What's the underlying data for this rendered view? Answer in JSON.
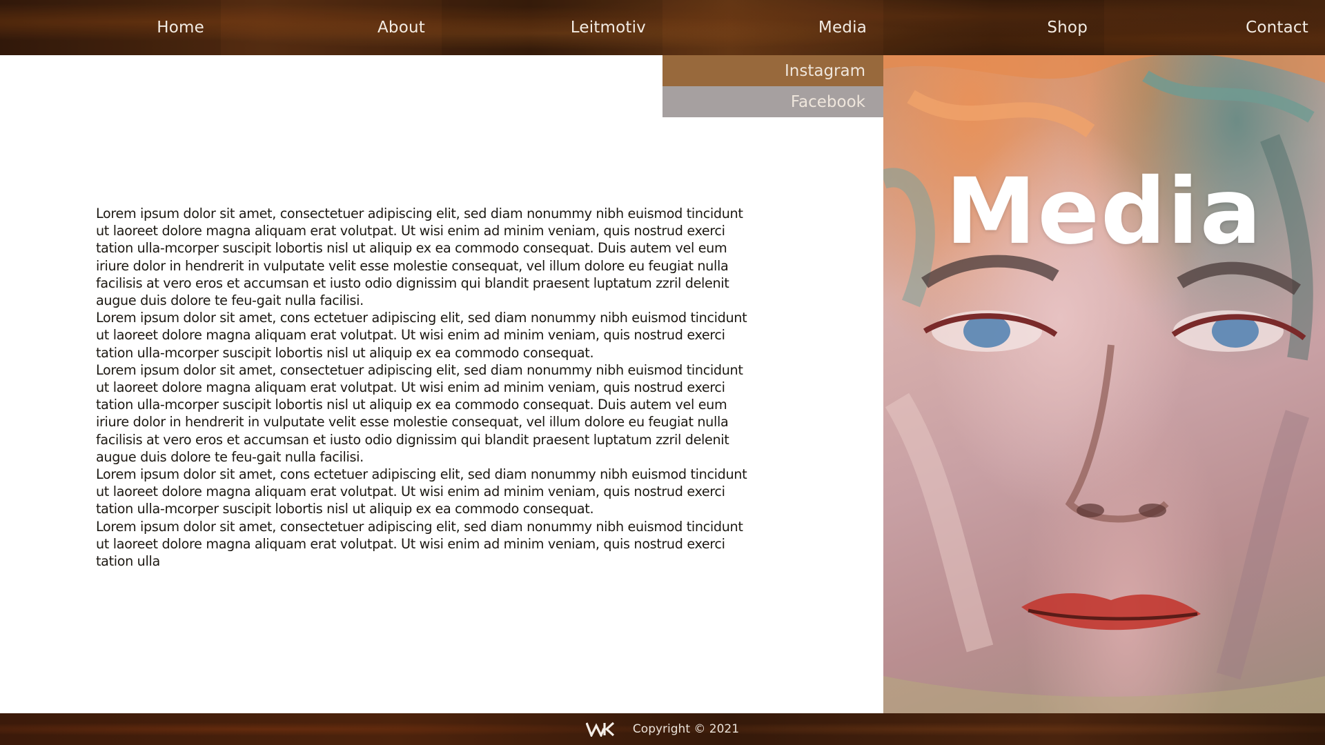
{
  "nav": {
    "items": [
      {
        "label": "Home"
      },
      {
        "label": "About"
      },
      {
        "label": "Leitmotiv"
      },
      {
        "label": "Media"
      },
      {
        "label": "Shop"
      },
      {
        "label": "Contact"
      }
    ],
    "dropdown": [
      {
        "label": "Instagram"
      },
      {
        "label": "Facebook"
      }
    ]
  },
  "hero": {
    "title": "Media"
  },
  "content": {
    "paragraphs": [
      "Lorem ipsum dolor sit amet, consectetuer adipiscing elit, sed diam nonummy nibh euismod tincidunt ut laoreet dolore magna aliquam erat volutpat. Ut wisi enim ad minim veniam, quis nostrud exerci tation ulla-mcorper suscipit lobortis nisl ut aliquip ex ea commodo consequat. Duis autem vel eum iriure dolor in hendrerit in vulputate velit esse molestie consequat, vel illum dolore eu feugiat nulla facilisis at vero eros et accumsan et iusto odio dignissim qui blandit praesent luptatum zzril delenit augue duis dolore te feu-gait nulla facilisi.",
      "Lorem ipsum dolor sit amet, cons ectetuer adipiscing elit, sed diam nonummy nibh euismod tincidunt ut laoreet dolore magna aliquam erat volutpat. Ut wisi enim ad minim veniam, quis nostrud exerci tation ulla-mcorper suscipit lobortis nisl ut aliquip ex ea commodo consequat.",
      "Lorem ipsum dolor sit amet, consectetuer adipiscing elit, sed diam nonummy nibh euismod tincidunt ut laoreet dolore magna aliquam erat volutpat. Ut wisi enim ad minim veniam, quis nostrud exerci tation ulla-mcorper suscipit lobortis nisl ut aliquip ex ea commodo consequat. Duis autem vel eum iriure dolor in hendrerit in vulputate velit esse molestie consequat, vel illum dolore eu feugiat nulla facilisis at vero eros et accumsan et iusto odio dignissim qui blandit praesent luptatum zzril delenit augue duis dolore te feu-gait nulla facilisi.",
      "Lorem ipsum dolor sit amet, cons ectetuer adipiscing elit, sed diam nonummy nibh euismod tincidunt ut laoreet dolore magna aliquam erat volutpat. Ut wisi enim ad minim veniam, quis nostrud exerci tation ulla-mcorper suscipit lobortis nisl ut aliquip ex ea commodo consequat.",
      "Lorem ipsum dolor sit amet, consectetuer adipiscing elit, sed diam nonummy nibh euismod tincidunt ut laoreet dolore magna aliquam erat volutpat. Ut wisi enim ad minim veniam, quis nostrud exerci tation ulla"
    ]
  },
  "footer": {
    "logo": "WK",
    "copyright": "Copyright © 2021"
  },
  "colors": {
    "nav_bg": "#4a260e",
    "dropdown_instagram": "#98693c",
    "dropdown_facebook": "#a6a0a0",
    "footer_bg": "#3b1a0a",
    "text": "#1c1812"
  }
}
